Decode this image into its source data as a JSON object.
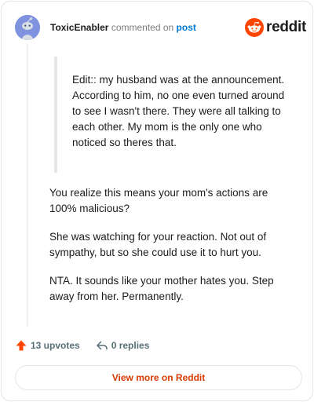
{
  "comment": {
    "author": "ToxicEnabler",
    "action_text": "commented on",
    "target_link": "post",
    "quote": "Edit:: my husband was at the announcement. According to him, no one even turned around to see I wasn't there. They were all talking to each other. My mom is the only one who noticed so theres that.",
    "paragraphs": [
      "You realize this means your mom's actions are 100% malicious?",
      "She was watching for your reaction. Not out of sympathy, but so she could use it to hurt you.",
      "NTA. It sounds like your mother hates you. Step away from her. Permanently."
    ],
    "upvotes_label": "13 upvotes",
    "replies_label": "0 replies"
  },
  "brand": {
    "name": "reddit",
    "icon": "reddit-logo-icon",
    "color": "#ff4500"
  },
  "footer": {
    "view_button_label": "View more on Reddit"
  },
  "colors": {
    "accent": "#ff4500",
    "link": "#0079d3",
    "button_text": "#d93a00",
    "avatar_bg": "#7f93e0"
  }
}
